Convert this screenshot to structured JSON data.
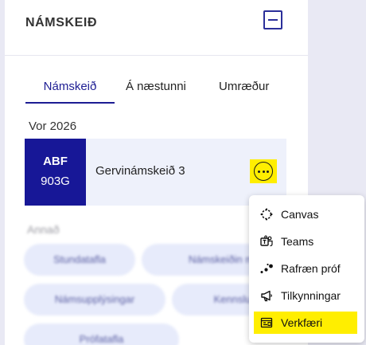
{
  "panel": {
    "title": "NÁMSKEIÐ"
  },
  "tabs": [
    {
      "label": "Námskeið",
      "active": true
    },
    {
      "label": "Á næstunni",
      "active": false
    },
    {
      "label": "Umræður",
      "active": false
    }
  ],
  "term": "Vor 2026",
  "course": {
    "code": "ABF",
    "number": "903G",
    "name": "Gervinámskeið 3"
  },
  "other": {
    "label": "Annað",
    "links": [
      "Stundatafla",
      "Námskeiðin m",
      "Námsupplýsingar",
      "Kennslusk",
      "Prófatafla"
    ]
  },
  "menu": {
    "items": [
      {
        "label": "Canvas",
        "icon": "canvas-icon"
      },
      {
        "label": "Teams",
        "icon": "teams-icon"
      },
      {
        "label": "Rafræn próf",
        "icon": "exam-icon"
      },
      {
        "label": "Tilkynningar",
        "icon": "megaphone-icon"
      },
      {
        "label": "Verkfæri",
        "icon": "tools-icon",
        "highlighted": true
      }
    ]
  },
  "colors": {
    "brand": "#171797",
    "highlight": "#ffee00",
    "background": "#e9e9f4"
  }
}
